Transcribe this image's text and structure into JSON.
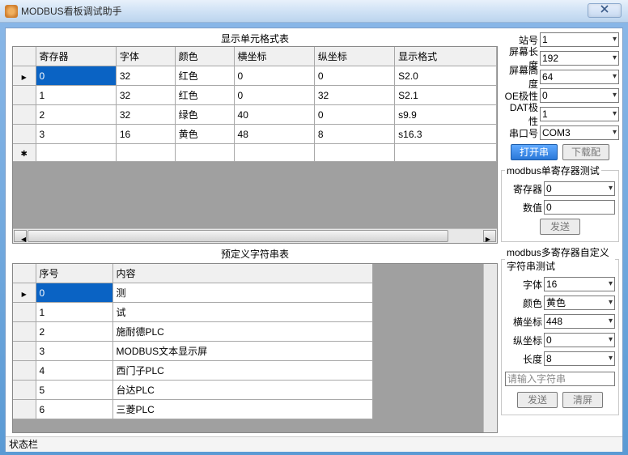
{
  "window": {
    "title": "MODBUS看板调试助手"
  },
  "grid1": {
    "title": "显示单元格式表",
    "headers": [
      "寄存器",
      "字体",
      "颜色",
      "横坐标",
      "纵坐标",
      "显示格式"
    ],
    "rows": [
      {
        "reg": "0",
        "font": "32",
        "color": "红色",
        "x": "0",
        "y": "0",
        "fmt": "S2.0"
      },
      {
        "reg": "1",
        "font": "32",
        "color": "红色",
        "x": "0",
        "y": "32",
        "fmt": "S2.1"
      },
      {
        "reg": "2",
        "font": "32",
        "color": "绿色",
        "x": "40",
        "y": "0",
        "fmt": "s9.9"
      },
      {
        "reg": "3",
        "font": "16",
        "color": "黄色",
        "x": "48",
        "y": "8",
        "fmt": "s16.3"
      }
    ]
  },
  "grid2": {
    "title": "预定义字符串表",
    "headers": [
      "序号",
      "内容"
    ],
    "rows": [
      {
        "idx": "0",
        "val": "测"
      },
      {
        "idx": "1",
        "val": "试"
      },
      {
        "idx": "2",
        "val": "施耐德PLC"
      },
      {
        "idx": "3",
        "val": "MODBUS文本显示屏"
      },
      {
        "idx": "4",
        "val": "西门子PLC"
      },
      {
        "idx": "5",
        "val": "台达PLC"
      },
      {
        "idx": "6",
        "val": "三菱PLC"
      }
    ]
  },
  "settings": {
    "station_label": "站号",
    "station": "1",
    "width_label": "屏幕长度",
    "width": "192",
    "height_label": "屏幕高度",
    "height": "64",
    "oe_label": "OE极性",
    "oe": "0",
    "dat_label": "DAT极性",
    "dat": "1",
    "port_label": "串口号",
    "port": "COM3",
    "open_btn": "打开串",
    "download_btn": "下载配"
  },
  "single": {
    "legend": "modbus单寄存器测试",
    "reg_label": "寄存器",
    "reg": "0",
    "val_label": "数值",
    "val": "0",
    "send_btn": "发送"
  },
  "multi": {
    "legend": "modbus多寄存器自定义字符串测试",
    "font_label": "字体",
    "font": "16",
    "color_label": "颜色",
    "color": "黄色",
    "x_label": "横坐标",
    "x": "448",
    "y_label": "纵坐标",
    "y": "0",
    "len_label": "长度",
    "len": "8",
    "placeholder": "请输入字符串",
    "send_btn": "发送",
    "clear_btn": "清屏"
  },
  "statusbar": "状态栏"
}
